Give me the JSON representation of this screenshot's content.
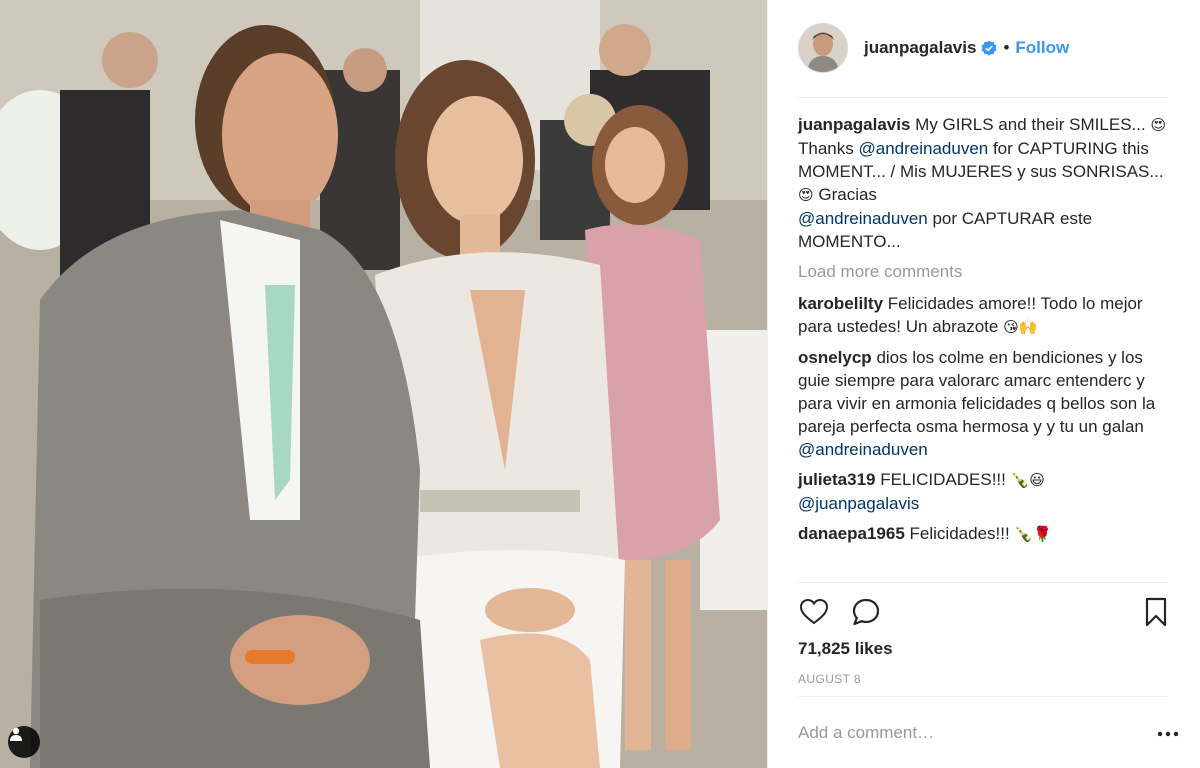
{
  "post": {
    "username": "juanpagalavis",
    "follow_label": "Follow",
    "separator": "•",
    "likes": "71,825 likes",
    "date": "AUGUST 8"
  },
  "caption": {
    "username": "juanpagalavis",
    "t1": "My GIRLS and their SMILES... ",
    "e1": "😍",
    "t2": " Thanks ",
    "m1": "@andreinaduven",
    "t3": " for CAPTURING this MOMENT... / Mis MUJERES y sus SONRISAS... ",
    "e2": "😍",
    "t4": " Gracias ",
    "m2": "@andreinaduven",
    "t5": " por CAPTURAR este MOMENTO..."
  },
  "load_more_label": "Load more comments",
  "comments": [
    {
      "username": "karobelilty",
      "text": "Felicidades amore!! Todo lo mejor para ustedes! Un abrazote ",
      "emoji": "😘🙌"
    },
    {
      "username": "osnelycp",
      "text": "dios los colme en bendiciones y los guie siempre para valorarc amarc entenderc y para vivir en armonia felicidades q bellos son la pareja perfecta osma hermosa y y tu un galan ",
      "mention": "@andreinaduven"
    },
    {
      "username": "julieta319",
      "text": "FELICIDADES!!! ",
      "emoji": "🍾😃",
      "mention": "@juanpagalavis"
    },
    {
      "username": "danaepa1965",
      "text": "Felicidades!!! ",
      "emoji": "🍾🌹"
    }
  ],
  "add_comment_placeholder": "Add a comment…",
  "icons": {
    "like": "heart-icon",
    "comment": "speech-bubble-icon",
    "save": "bookmark-icon",
    "more": "ellipsis-icon",
    "verified": "verified-badge-icon",
    "user_tag": "person-tag-icon"
  },
  "colors": {
    "link_blue": "#3897f0",
    "mention_blue": "#003569",
    "text": "#262626",
    "muted": "#999999",
    "border": "#efefef"
  }
}
